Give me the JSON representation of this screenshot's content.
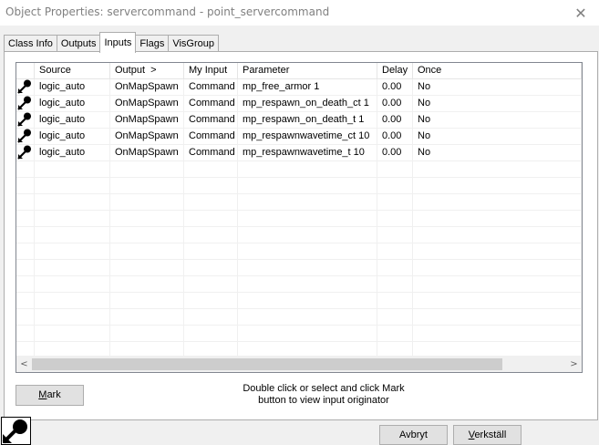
{
  "window": {
    "title": "Object Properties: servercommand - point_servercommand",
    "close_glyph": "✕"
  },
  "tabs": [
    {
      "label": "Class Info",
      "active": false
    },
    {
      "label": "Outputs",
      "active": false
    },
    {
      "label": "Inputs",
      "active": true
    },
    {
      "label": "Flags",
      "active": false
    },
    {
      "label": "VisGroup",
      "active": false
    }
  ],
  "table": {
    "columns": [
      "",
      "Source",
      "Output  >",
      "My Input",
      "Parameter",
      "Delay",
      "Once"
    ],
    "rows": [
      {
        "icon": "connection-icon",
        "source": "logic_auto",
        "output": "OnMapSpawn",
        "input": "Command",
        "parameter": "mp_free_armor 1",
        "delay": "0.00",
        "once": "No"
      },
      {
        "icon": "connection-icon",
        "source": "logic_auto",
        "output": "OnMapSpawn",
        "input": "Command",
        "parameter": "mp_respawn_on_death_ct 1",
        "delay": "0.00",
        "once": "No"
      },
      {
        "icon": "connection-icon",
        "source": "logic_auto",
        "output": "OnMapSpawn",
        "input": "Command",
        "parameter": "mp_respawn_on_death_t 1",
        "delay": "0.00",
        "once": "No"
      },
      {
        "icon": "connection-icon",
        "source": "logic_auto",
        "output": "OnMapSpawn",
        "input": "Command",
        "parameter": "mp_respawnwavetime_ct 10",
        "delay": "0.00",
        "once": "No"
      },
      {
        "icon": "connection-icon",
        "source": "logic_auto",
        "output": "OnMapSpawn",
        "input": "Command",
        "parameter": "mp_respawnwavetime_t 10",
        "delay": "0.00",
        "once": "No"
      }
    ]
  },
  "scrollbar": {
    "left": "<",
    "right": ">"
  },
  "mark_button": {
    "access_key": "M",
    "rest": "ark"
  },
  "hint": {
    "line1": "Double click or select and click Mark",
    "line2": "button to view input originator"
  },
  "footer": {
    "ok_label": "Avbryt",
    "apply_access_key": "V",
    "apply_rest": "erkställ"
  },
  "colors": {
    "accent_border": "#adadad",
    "list_border": "#828790"
  }
}
